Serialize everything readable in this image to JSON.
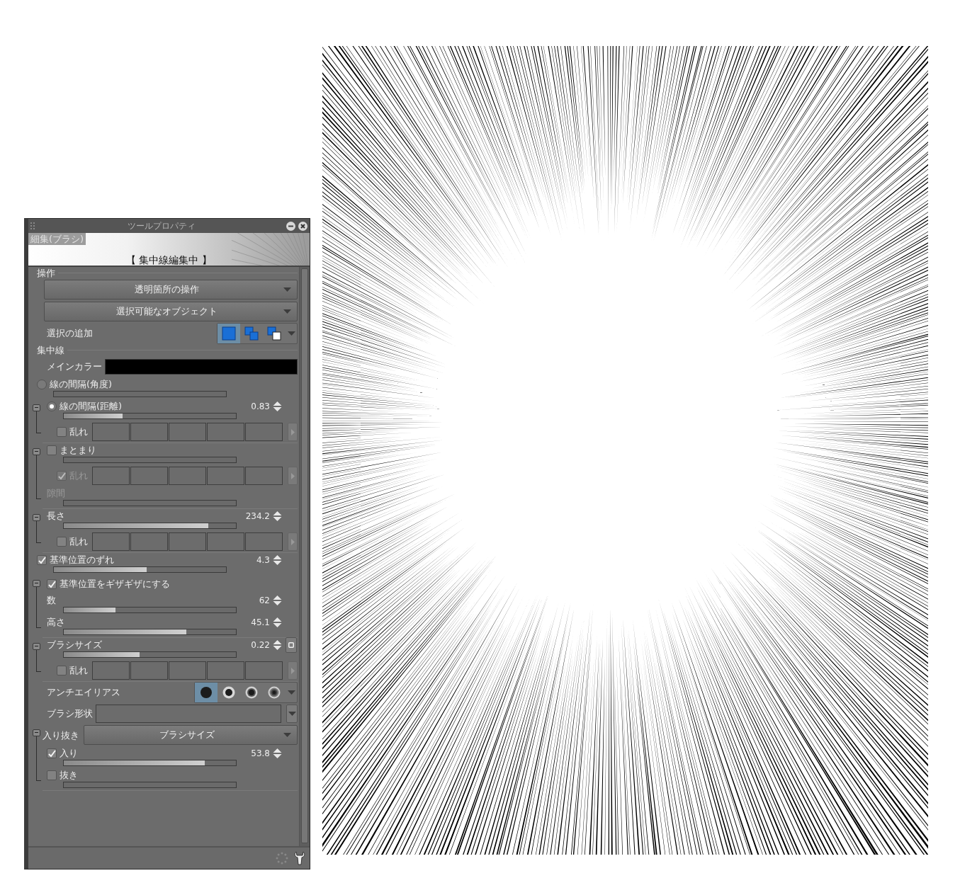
{
  "panel": {
    "title": "ツールプロパティ",
    "tool_name": "細集(ブラシ)",
    "status": "【 集中線編集中 】"
  },
  "rows": [
    {
      "kind": "heading",
      "label": "操作"
    },
    {
      "kind": "dropdown",
      "value": "透明箇所の操作"
    },
    {
      "kind": "dropdown",
      "value": "選択可能なオブジェクト"
    },
    {
      "kind": "square_choice",
      "label": "選択の追加",
      "options": [
        {
          "selected": true
        },
        {
          "selected": false
        },
        {
          "selected": false
        }
      ]
    },
    {
      "kind": "heading",
      "label": "集中線"
    },
    {
      "kind": "color",
      "label": "メインカラー",
      "color": "#000000"
    },
    {
      "kind": "radio_slider",
      "selected": false,
      "label": "線の間隔(角度)",
      "level": 0
    },
    {
      "kind": "radio_slider",
      "selected": true,
      "label": "線の間隔(距離)",
      "level": 0.34,
      "reading": "0.83",
      "expanded": true,
      "children": [
        {
          "kind": "random",
          "label": "乱れ",
          "checked": false
        }
      ]
    },
    {
      "kind": "check_slider",
      "checked": false,
      "label": "まとまり",
      "level": 0,
      "expanded": true,
      "children": [
        {
          "kind": "random",
          "label": "乱れ",
          "checked": true,
          "disabled": true
        },
        {
          "kind": "slider",
          "label": "隙間",
          "level": 0,
          "disabled": true
        }
      ]
    },
    {
      "kind": "slider",
      "label": "長さ",
      "level": 0.84,
      "reading": "234.2",
      "expanded": true,
      "children": [
        {
          "kind": "random",
          "label": "乱れ",
          "checked": false
        }
      ]
    },
    {
      "kind": "check_slider",
      "checked": true,
      "label": "基準位置のずれ",
      "level": 0.54,
      "reading": "4.3"
    },
    {
      "kind": "check_group",
      "checked": true,
      "label": "基準位置をギザギザにする",
      "expanded": true,
      "children": [
        {
          "kind": "slider",
          "label": "数",
          "level": 0.3,
          "reading": "62"
        },
        {
          "kind": "slider",
          "label": "高さ",
          "level": 0.71,
          "reading": "45.1"
        }
      ]
    },
    {
      "kind": "slider",
      "label": "ブラシサイズ",
      "level": 0.44,
      "reading": "0.22",
      "side_button": true,
      "expanded": true,
      "children": [
        {
          "kind": "random",
          "label": "乱れ",
          "checked": false
        }
      ]
    },
    {
      "kind": "dot_choice",
      "label": "アンチエイリアス",
      "options": [
        {
          "selected": true
        },
        {
          "selected": false
        },
        {
          "selected": false
        },
        {
          "selected": false
        }
      ]
    },
    {
      "kind": "field",
      "label": "ブラシ形状"
    },
    {
      "kind": "dropdown",
      "label": "入り抜き",
      "value": "ブラシサイズ",
      "expanded": true,
      "children": [
        {
          "kind": "check_slider",
          "checked": true,
          "label": "入り",
          "level": 0.82,
          "reading": "53.8"
        },
        {
          "kind": "check_slider",
          "checked": false,
          "label": "抜き",
          "level": 0
        }
      ]
    }
  ],
  "canvas": {
    "kind": "speed_lines"
  }
}
